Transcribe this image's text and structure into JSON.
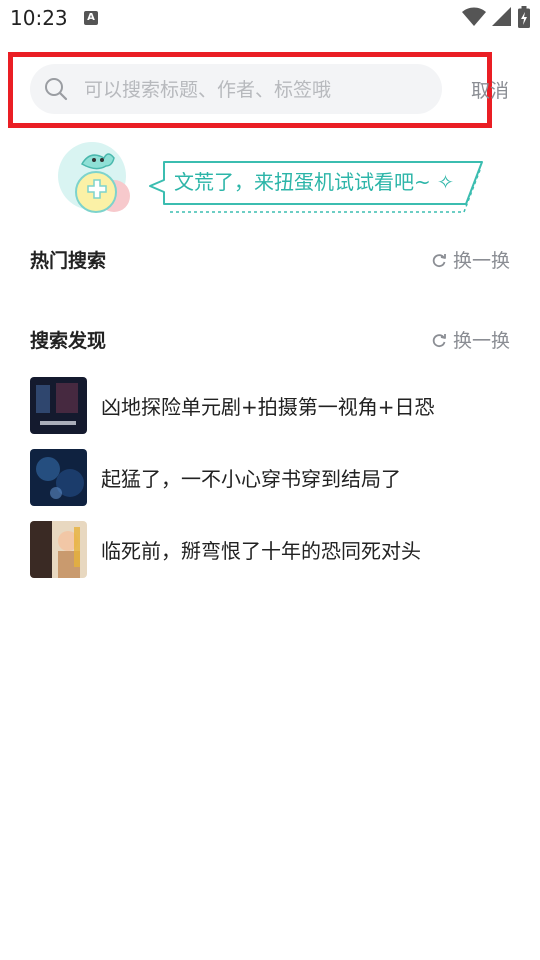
{
  "status_bar": {
    "time": "10:23",
    "notification_icon": "a-icon",
    "icons": [
      "wifi-icon",
      "signal-icon",
      "battery-icon"
    ]
  },
  "search": {
    "placeholder": "可以搜索标题、作者、标签哦",
    "value": "",
    "cancel_label": "取消"
  },
  "banner": {
    "text": "文荒了，来扭蛋机试试看吧~ ✧"
  },
  "hot_search": {
    "title": "热门搜索",
    "refresh_label": "换一换"
  },
  "discover": {
    "title": "搜索发现",
    "refresh_label": "换一换",
    "items": [
      {
        "title": "凶地探险单元剧+拍摄第一视角+日恐"
      },
      {
        "title": "起猛了，一不小心穿书穿到结局了"
      },
      {
        "title": "临死前，掰弯恨了十年的恐同死对头"
      }
    ]
  },
  "colors": {
    "accent": "#2cb5a8",
    "highlight_border": "#ea1e24",
    "muted_text": "#8b8e94",
    "search_bg": "#f3f4f6"
  }
}
